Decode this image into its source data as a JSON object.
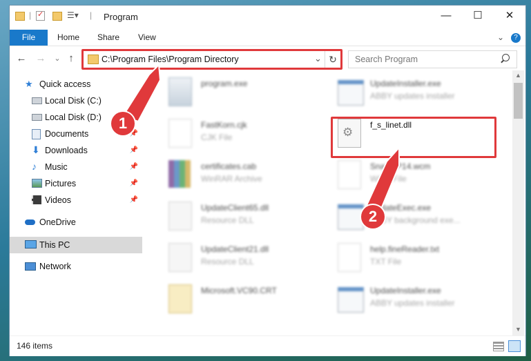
{
  "window": {
    "title": "Program",
    "controls": {
      "minimize": "—",
      "maximize": "☐",
      "close": "✕"
    }
  },
  "ribbon": {
    "tabs": [
      "File",
      "Home",
      "Share",
      "View"
    ]
  },
  "address_bar": {
    "path": "C:\\Program Files\\Program Directory",
    "dropdown": "⌄",
    "refresh": "↻"
  },
  "search": {
    "placeholder": "Search Program",
    "icon": "search-icon"
  },
  "nav_buttons": {
    "back": "←",
    "forward": "→",
    "recent": "⌄",
    "up": "↑"
  },
  "sidebar": {
    "items": [
      {
        "label": "Quick access",
        "icon": "star-icon"
      },
      {
        "label": "Local Disk (C:)",
        "icon": "drive-icon"
      },
      {
        "label": "Local Disk (D:)",
        "icon": "drive-icon"
      },
      {
        "label": "Documents",
        "icon": "documents-icon"
      },
      {
        "label": "Downloads",
        "icon": "download-icon"
      },
      {
        "label": "Music",
        "icon": "music-icon"
      },
      {
        "label": "Pictures",
        "icon": "pictures-icon"
      },
      {
        "label": "Videos",
        "icon": "videos-icon"
      },
      {
        "label": "OneDrive",
        "icon": "cloud-icon"
      },
      {
        "label": "This PC",
        "icon": "computer-icon"
      },
      {
        "label": "Network",
        "icon": "network-icon"
      }
    ]
  },
  "files": [
    {
      "name": "program.exe",
      "type": ""
    },
    {
      "name": "UpdateInstaller.exe",
      "type": "ABBY updates installer"
    },
    {
      "name": "FastKorn.cjk",
      "type": "CJK File"
    },
    {
      "name": "f_s_linet.dll",
      "type": ""
    },
    {
      "name": "certificates.cab",
      "type": "WinRAR Archive"
    },
    {
      "name": "SnailWP14.wcm",
      "type": "WCM File"
    },
    {
      "name": "UpdateClient65.dll",
      "type": "Resource DLL"
    },
    {
      "name": "UpdateExec.exe",
      "type": "ABBY background exe..."
    },
    {
      "name": "UpdateClient21.dll",
      "type": "Resource DLL"
    },
    {
      "name": "help.fineReader.txt",
      "type": "TXT File"
    },
    {
      "name": "Microsoft.VC90.CRT",
      "type": ""
    },
    {
      "name": "UpdateInstaller.exe",
      "type": "ABBY updates installer"
    }
  ],
  "status": {
    "item_count": "146 items"
  },
  "annotations": {
    "marker1": "1",
    "marker2": "2",
    "accent": "#e0393b"
  },
  "colors": {
    "file_tab": "#1979ca",
    "selected_nav": "#cce8ff"
  }
}
